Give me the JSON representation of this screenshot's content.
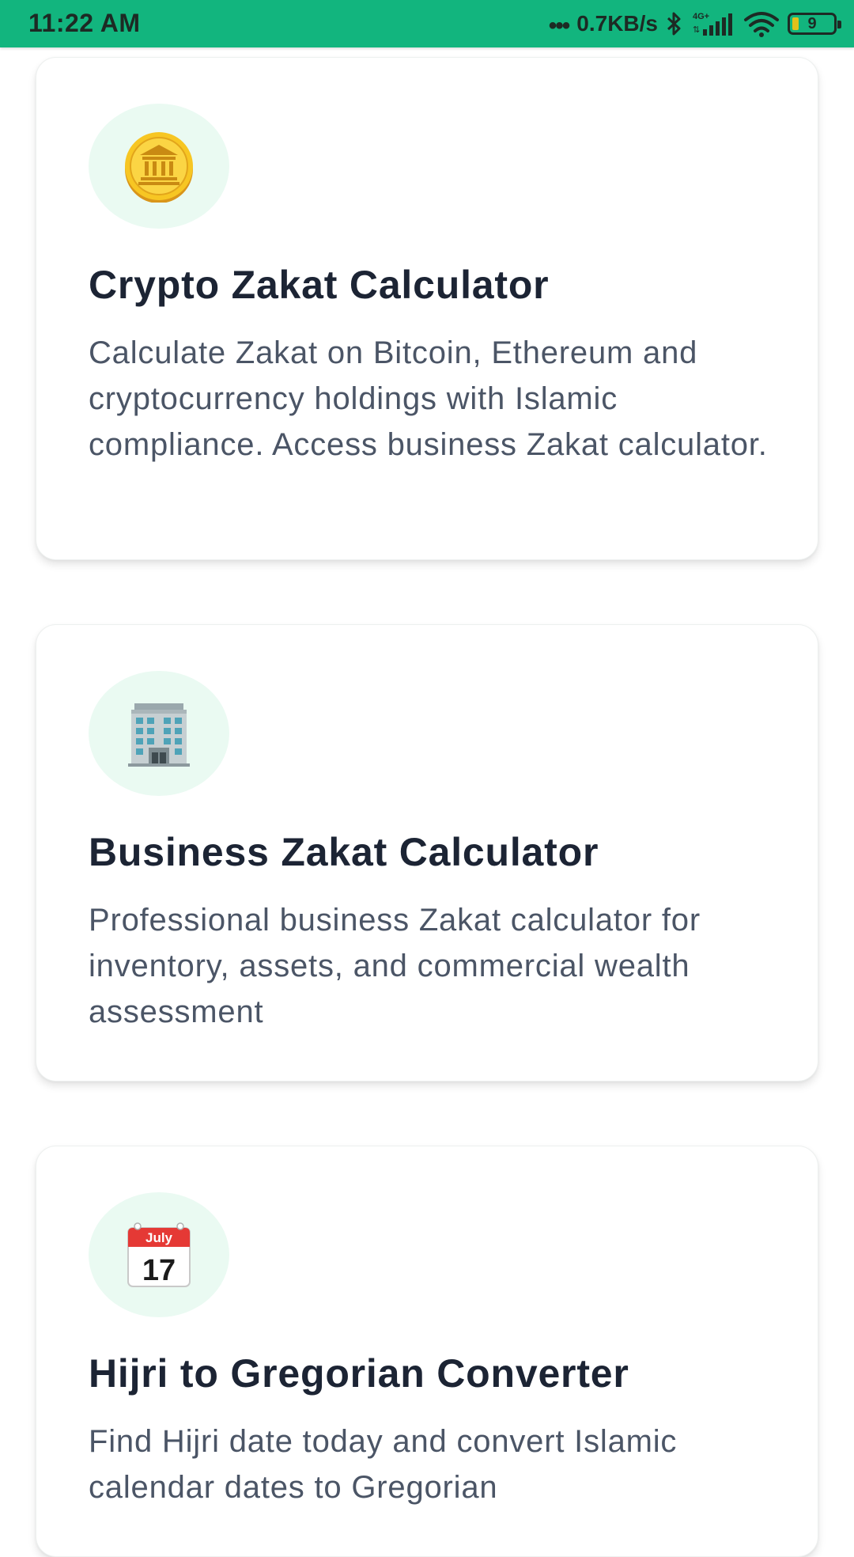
{
  "status_bar": {
    "time": "11:22 AM",
    "dots": "•••",
    "network_speed": "0.7KB/s",
    "network_type": "4G+",
    "battery_level": "9",
    "battery_color": "#e3c11a",
    "background_color": "#12b57e",
    "icons": [
      "bluetooth-icon",
      "signal-icon",
      "wifi-icon",
      "battery-icon"
    ]
  },
  "cards": [
    {
      "icon": "bank-coin-icon",
      "title": "Crypto Zakat Calculator",
      "description": "Calculate Zakat on Bitcoin, Ethereum and cryptocurrency holdings with Islamic compliance. Access business Zakat calculator."
    },
    {
      "icon": "office-building-icon",
      "title": "Business Zakat Calculator",
      "description": "Professional business Zakat calculator for inventory, assets, and commercial wealth assessment"
    },
    {
      "icon": "calendar-icon",
      "calendar_month": "July",
      "calendar_day": "17",
      "title": "Hijri to Gregorian Converter",
      "description": "Find Hijri date today and convert Islamic calendar dates to Gregorian"
    }
  ],
  "colors": {
    "accent": "#12b57e",
    "icon_circle": "#eafaf2",
    "title": "#1c2434",
    "description": "#4b5566"
  }
}
